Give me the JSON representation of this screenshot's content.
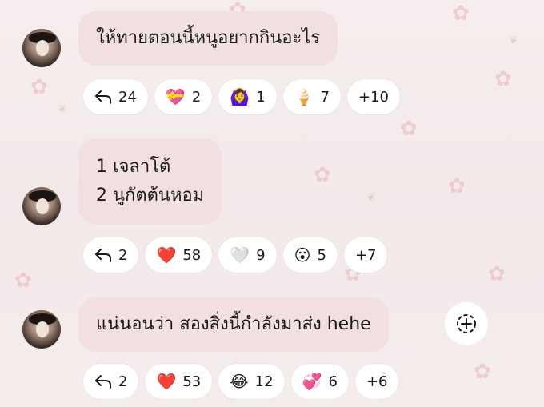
{
  "messages": [
    {
      "text_lines": [
        "ให้ทายตอนนี้หนูอยากกินอะไร"
      ],
      "reactions": {
        "reply_count": "24",
        "items": [
          {
            "emoji": "💝",
            "count": "2",
            "icon": "heart-gift-icon"
          },
          {
            "emoji": "🙆‍♀️",
            "count": "1",
            "icon": "person-gesturing-ok-icon"
          },
          {
            "emoji": "🍦",
            "count": "7",
            "icon": "ice-cream-icon"
          }
        ],
        "more": "+10"
      }
    },
    {
      "text_lines": [
        "1 เจลาโต้",
        "2 นูกัตต้นหอม"
      ],
      "reactions": {
        "reply_count": "2",
        "items": [
          {
            "emoji": "❤️",
            "count": "58",
            "icon": "red-heart-icon"
          },
          {
            "emoji": "🤍",
            "count": "9",
            "icon": "white-heart-icon"
          },
          {
            "emoji": "😮",
            "count": "5",
            "icon": "surprised-face-icon"
          }
        ],
        "more": "+7"
      }
    },
    {
      "text_lines": [
        "แน่นอนว่า สองสิ่งนี้กำลังมาส่ง hehe"
      ],
      "reactions": {
        "reply_count": "2",
        "items": [
          {
            "emoji": "❤️",
            "count": "53",
            "icon": "red-heart-icon"
          },
          {
            "emoji": "😂",
            "count": "12",
            "icon": "tears-of-joy-icon"
          },
          {
            "emoji": "💞",
            "count": "6",
            "icon": "revolving-hearts-icon"
          }
        ],
        "more": "+6"
      }
    }
  ],
  "add_reaction_icon": "add-reaction-icon",
  "colors": {
    "bubble": "#f2dfe2",
    "pill": "#ffffff",
    "text": "#1a1a1a"
  }
}
